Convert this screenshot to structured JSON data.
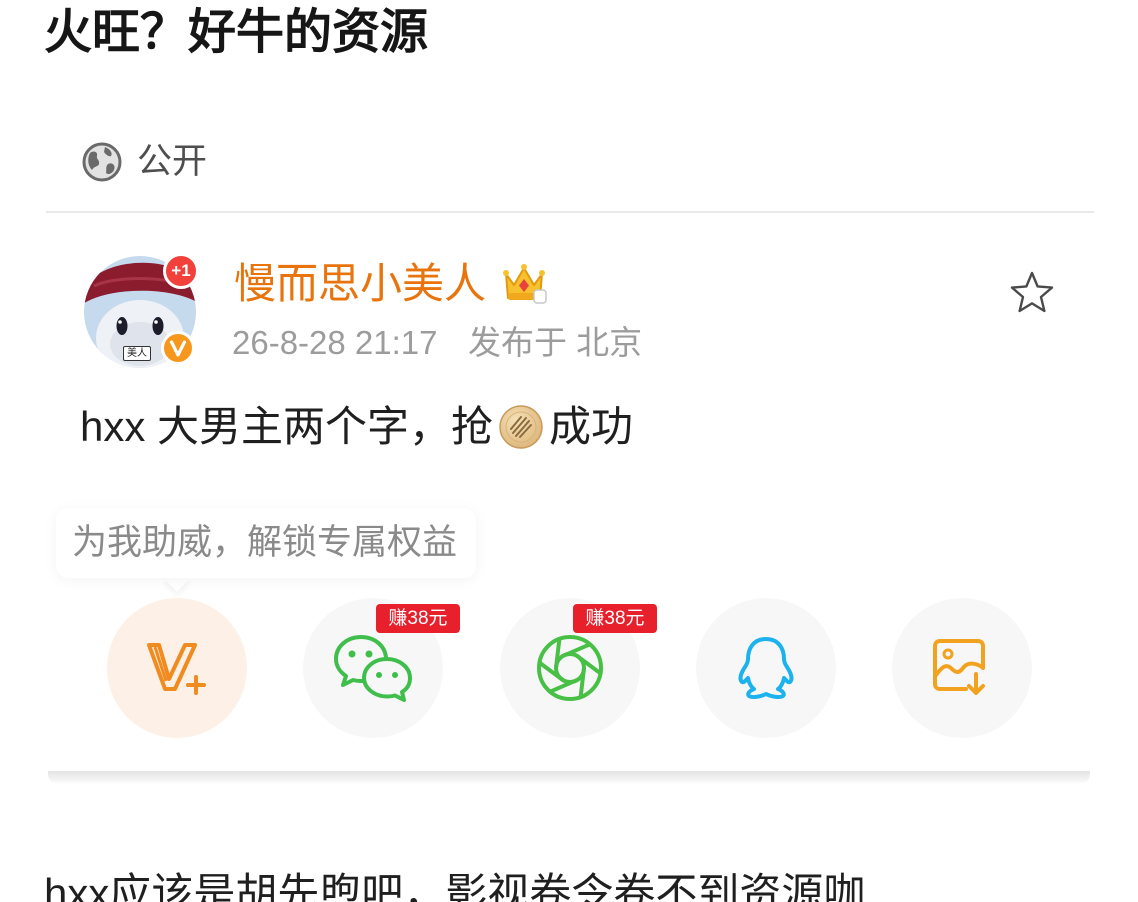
{
  "post": {
    "title": "火旺？好牛的资源",
    "visibility": {
      "icon": "globe-icon",
      "label": "公开"
    }
  },
  "card": {
    "author": {
      "name": "慢而思小美人",
      "avatar_badge": "+1",
      "avatar_tag": "美人",
      "verified_icon": "verified-icon",
      "member_icon": "crown-icon"
    },
    "time": "26-8-28 21:17",
    "location": "发布于 北京",
    "content": {
      "before_emoji": "hxx 大男主两个字，抢",
      "emoji": "pie-emoji-icon",
      "after_emoji": "成功"
    },
    "favorite_icon": "star-icon"
  },
  "support": {
    "prompt": "为我助威，解锁专属权益",
    "buttons": [
      {
        "icon": "vplus-icon"
      },
      {
        "icon": "wechat-icon",
        "badge": "赚38元"
      },
      {
        "icon": "moments-icon",
        "badge": "赚38元"
      },
      {
        "icon": "qq-icon"
      },
      {
        "icon": "save-image-icon"
      }
    ]
  },
  "comment": {
    "text": "hxx应该是胡先煦吧，影视卷令卷不到资源咖"
  },
  "colors": {
    "username": "#e8740e",
    "verified": "#f7981d",
    "badge_red": "#e8202c",
    "plus_badge": "#f2413b",
    "wechat_green": "#40be4c",
    "moments_green": "#48c046",
    "qq_blue": "#1cb2ee",
    "vplus_orange": "#f08b1f",
    "save_orange": "#f2a21f",
    "vplus_bg": "#fdf0e6",
    "share_bg": "#f7f7f7"
  }
}
